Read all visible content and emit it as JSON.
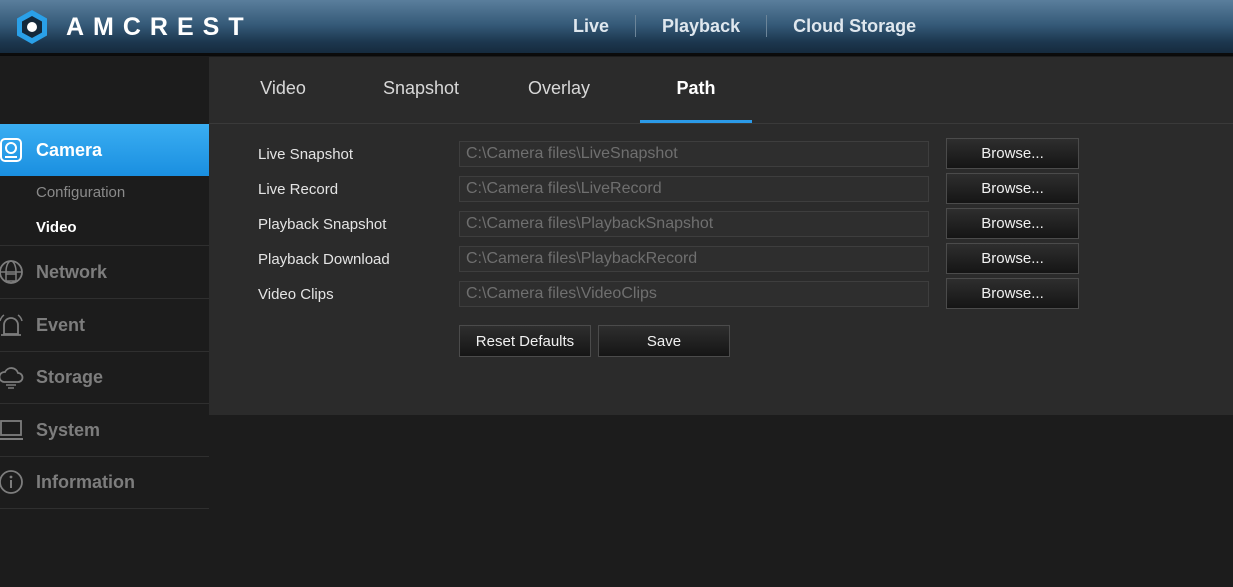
{
  "header": {
    "brand": "AMCREST",
    "nav": [
      {
        "label": "Live"
      },
      {
        "label": "Playback"
      },
      {
        "label": "Cloud Storage"
      }
    ]
  },
  "sidebar": {
    "camera": {
      "label": "Camera",
      "items": [
        {
          "label": "Configuration",
          "active": false
        },
        {
          "label": "Video",
          "active": true
        }
      ]
    },
    "network": {
      "label": "Network"
    },
    "event": {
      "label": "Event"
    },
    "storage": {
      "label": "Storage"
    },
    "system": {
      "label": "System"
    },
    "information": {
      "label": "Information"
    }
  },
  "tabs": [
    {
      "label": "Video"
    },
    {
      "label": "Snapshot"
    },
    {
      "label": "Overlay"
    },
    {
      "label": "Path",
      "active": true
    }
  ],
  "paths": [
    {
      "label": "Live Snapshot",
      "value": "C:\\Camera files\\LiveSnapshot",
      "browse": "Browse..."
    },
    {
      "label": "Live Record",
      "value": "C:\\Camera files\\LiveRecord",
      "browse": "Browse..."
    },
    {
      "label": "Playback Snapshot",
      "value": "C:\\Camera files\\PlaybackSnapshot",
      "browse": "Browse..."
    },
    {
      "label": "Playback Download",
      "value": "C:\\Camera files\\PlaybackRecord",
      "browse": "Browse..."
    },
    {
      "label": "Video Clips",
      "value": "C:\\Camera files\\VideoClips",
      "browse": "Browse..."
    }
  ],
  "actions": {
    "reset": "Reset Defaults",
    "save": "Save"
  },
  "colors": {
    "accent": "#2b9ae8",
    "sidebar_active": "#1a8fe0",
    "panel": "#2b2b2b",
    "background": "#1c1c1c"
  }
}
